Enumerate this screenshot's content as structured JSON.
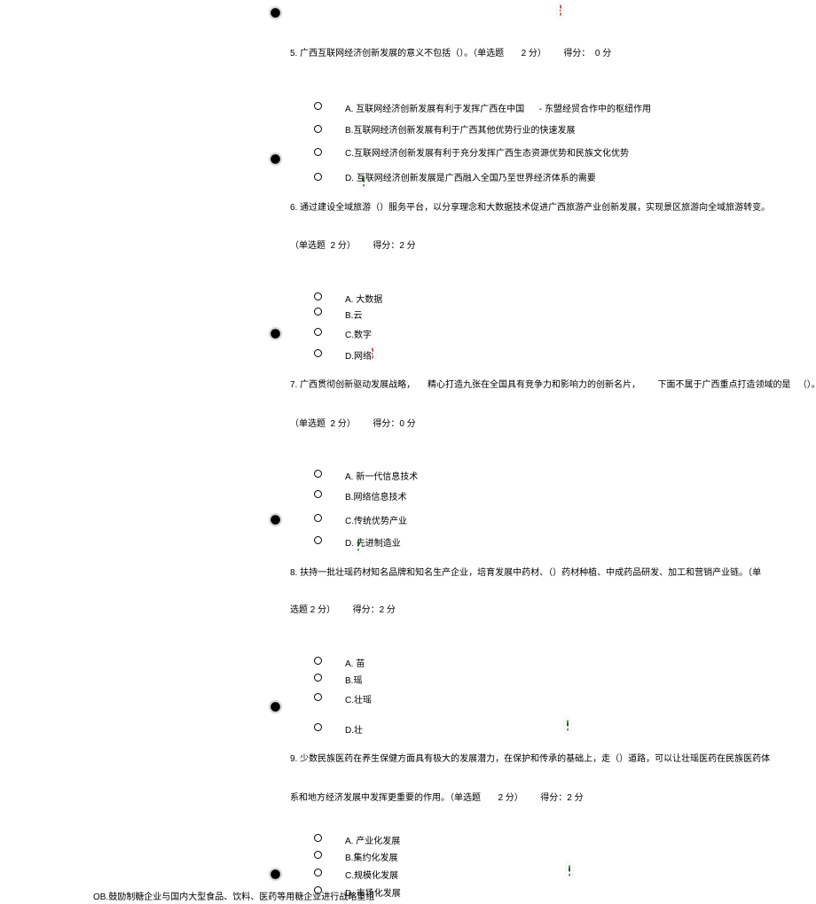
{
  "q5": {
    "stem": "5. 广西互联网经济创新发展的意义不包括（）。（单选题       2 分）       得分：  0 分",
    "a": "A. 互联网经济创新发展有利于发挥广西在中国      - 东盟经贸合作中的枢纽作用",
    "b": "B.互联网经济创新发展有利于广西其他优势行业的快速发展",
    "c": "C.互联网经济创新发展有利于充分发挥广西生态资源优势和民族文化优势",
    "d": "D. 互联网经济创新发展是广西融入全国乃至世界经济体系的需要"
  },
  "q6": {
    "stem": "6. 通过建设全域旅游（）服务平台，以分享理念和大数据技术促进广西旅游产业创新发展，实现景区旅游向全域旅游转变。",
    "meta": "（单选题  2 分）       得分：2 分",
    "a": "A. 大数据",
    "b": "B.云",
    "c": "C.数字",
    "d": "D.网络"
  },
  "q7": {
    "stem": "7. 广西贯彻创新驱动发展战略，     精心打造九张在全国具有竞争力和影响力的创新名片，       下面不属于广西重点打造领域的是   （）。",
    "meta": "（单选题  2 分）       得分：0 分",
    "a": "A. 新一代信息技术",
    "b": "B.网络信息技术",
    "c": "C.传统优势产业",
    "d": "D. 先进制造业"
  },
  "q8": {
    "stem": "8. 扶持一批壮瑶药材知名品牌和知名生产企业，培育发展中药材、（）药材种植、中成药品研发、加工和营销产业链。（单",
    "meta": "选题 2 分）       得分：2 分",
    "a": "A. 苗",
    "b": "B.瑶",
    "c": "C.壮瑶",
    "d": "D.壮"
  },
  "q9": {
    "stem": "9. 少数民族医药在养生保健方面具有极大的发展潜力，在保护和传承的基础上，走（）道路，可以让壮瑶医药在民族医药体",
    "meta": "系和地方经济发展中发挥更重要的作用。（单选题       2 分）       得分：2 分",
    "a": "A. 产业化发展",
    "b": "B.集约化发展",
    "c": "C.规模化发展",
    "d": "D. 市场化发展"
  },
  "footer": "OB.鼓励制糖企业与国内大型食品、饮料、医药等用糖企业进行战略重组",
  "icon": {
    "wrong": "wrong-badge",
    "right": "right-badge"
  },
  "colors": {
    "red": "#e53935",
    "green": "#43a047"
  }
}
